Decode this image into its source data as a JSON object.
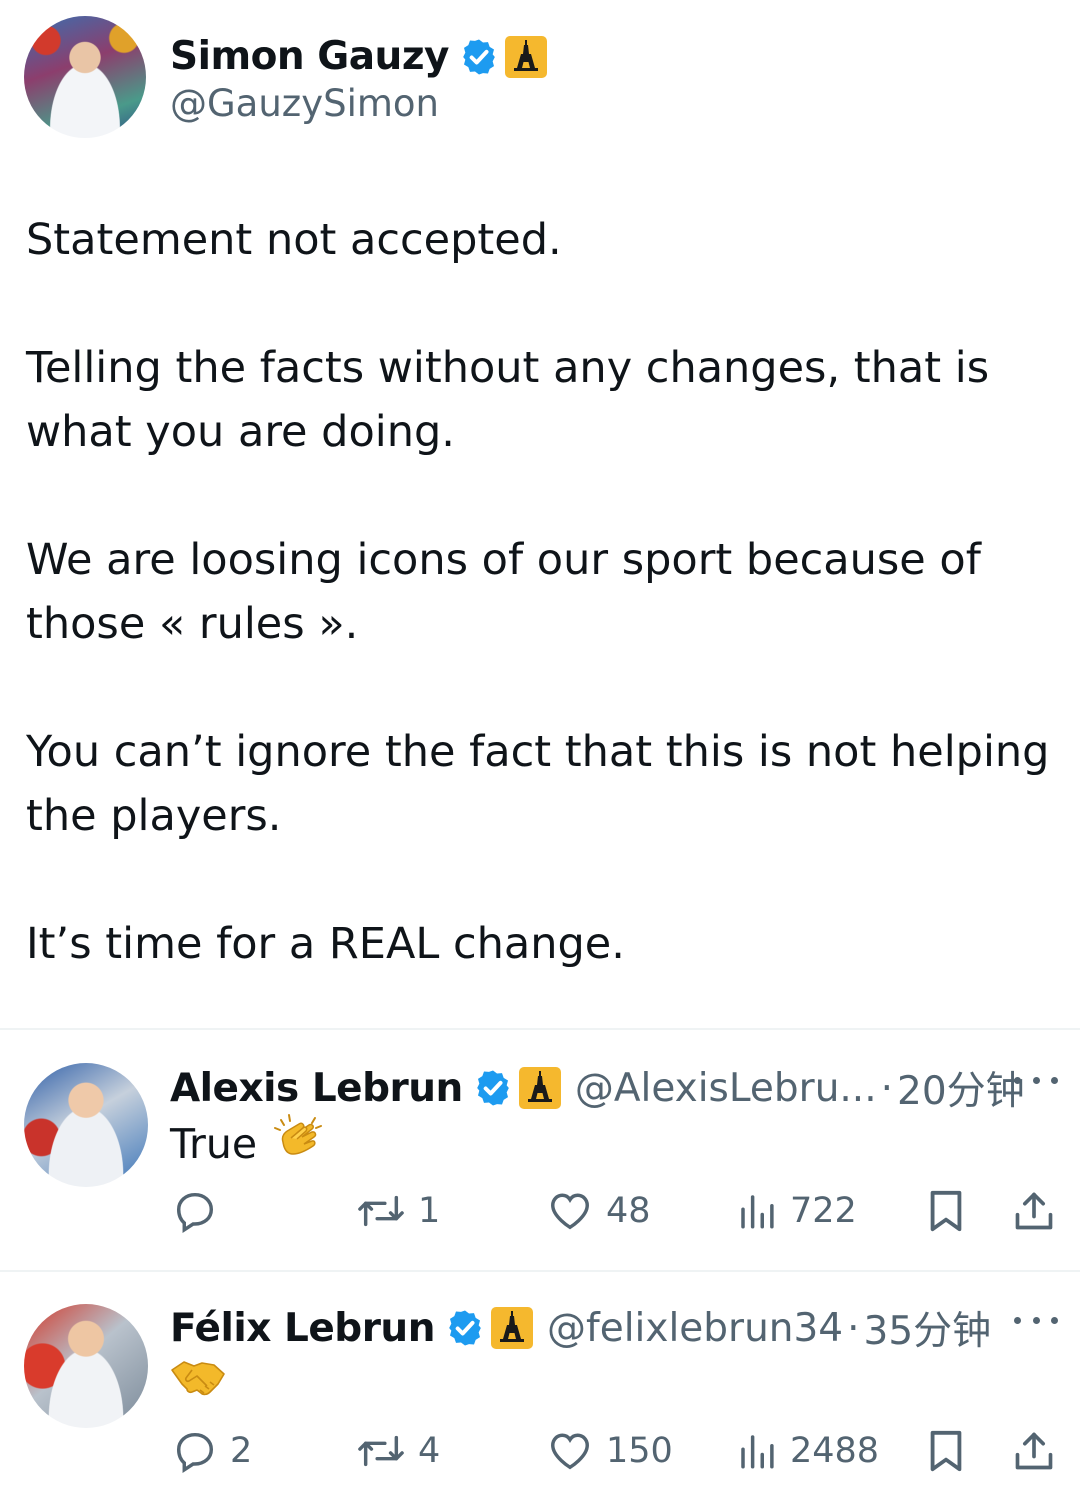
{
  "main_tweet": {
    "author_name": "Simon Gauzy",
    "handle": "@GauzySimon",
    "paragraphs": [
      "Statement not accepted.",
      "Telling the facts without any changes, that is\nwhat you are doing.",
      "We are loosing icons of our sport because of\nthose « rules ».",
      "You can’t ignore the fact that this is not helping\nthe players.",
      "It’s time for a REAL change."
    ]
  },
  "replies": [
    {
      "author_name": "Alexis Lebrun",
      "handle": "@AlexisLebru...",
      "separator": "·",
      "time": "20分钟",
      "text": "True",
      "emoji": "clapping-hands",
      "stats": {
        "replies": "",
        "reposts": "1",
        "likes": "48",
        "views": "722"
      }
    },
    {
      "author_name": "Félix Lebrun",
      "handle": "@felixlebrun34",
      "separator": "·",
      "time": "35分钟",
      "text": "",
      "emoji": "handshake",
      "stats": {
        "replies": "2",
        "reposts": "4",
        "likes": "150",
        "views": "2488"
      }
    }
  ],
  "colors": {
    "verified": "#1d9bf0",
    "secondary_text": "#536471",
    "primary_text": "#0f1419",
    "eiffel_badge": "#f5b82e"
  }
}
